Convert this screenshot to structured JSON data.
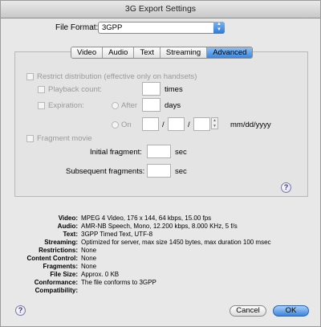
{
  "window": {
    "title": "3G Export Settings"
  },
  "file_format": {
    "label": "File Format:",
    "value": "3GPP",
    "arrow_icon": "updown-arrows-icon"
  },
  "tabs": [
    {
      "label": "Video",
      "active": false
    },
    {
      "label": "Audio",
      "active": false
    },
    {
      "label": "Text",
      "active": false
    },
    {
      "label": "Streaming",
      "active": false
    },
    {
      "label": "Advanced",
      "active": true
    }
  ],
  "advanced": {
    "restrict": "Restrict distribution (effective only on handsets)",
    "playback_count": "Playback count:",
    "times": "times",
    "expiration": "Expiration:",
    "after": "After",
    "days": "days",
    "on": "On",
    "slash": "/",
    "date_format": "mm/dd/yyyy",
    "fragment_movie": "Fragment movie",
    "initial_fragment": "Initial fragment:",
    "subsequent_fragments": "Subsequent fragments:",
    "sec": "sec"
  },
  "summary": [
    {
      "key": "Video:",
      "value": "MPEG 4 Video, 176 x 144, 64 kbps, 15.00 fps"
    },
    {
      "key": "Audio:",
      "value": "AMR-NB Speech, Mono, 12.200 kbps, 8.000 KHz, 5 f/s"
    },
    {
      "key": "Text:",
      "value": "3GPP Timed Text, UTF-8"
    },
    {
      "key": "Streaming:",
      "value": "Optimized for server, max size 1450 bytes, max duration 100 msec"
    },
    {
      "key": "Restrictions:",
      "value": "None"
    },
    {
      "key": "Content Control:",
      "value": "None"
    },
    {
      "key": "Fragments:",
      "value": "None"
    },
    {
      "key": "File Size:",
      "value": "Approx. 0 KB"
    },
    {
      "key": "Conformance:",
      "value": "The file conforms to 3GPP"
    },
    {
      "key": "Compatibility:",
      "value": ""
    }
  ],
  "buttons": {
    "cancel": "Cancel",
    "ok": "OK",
    "help": "?"
  }
}
